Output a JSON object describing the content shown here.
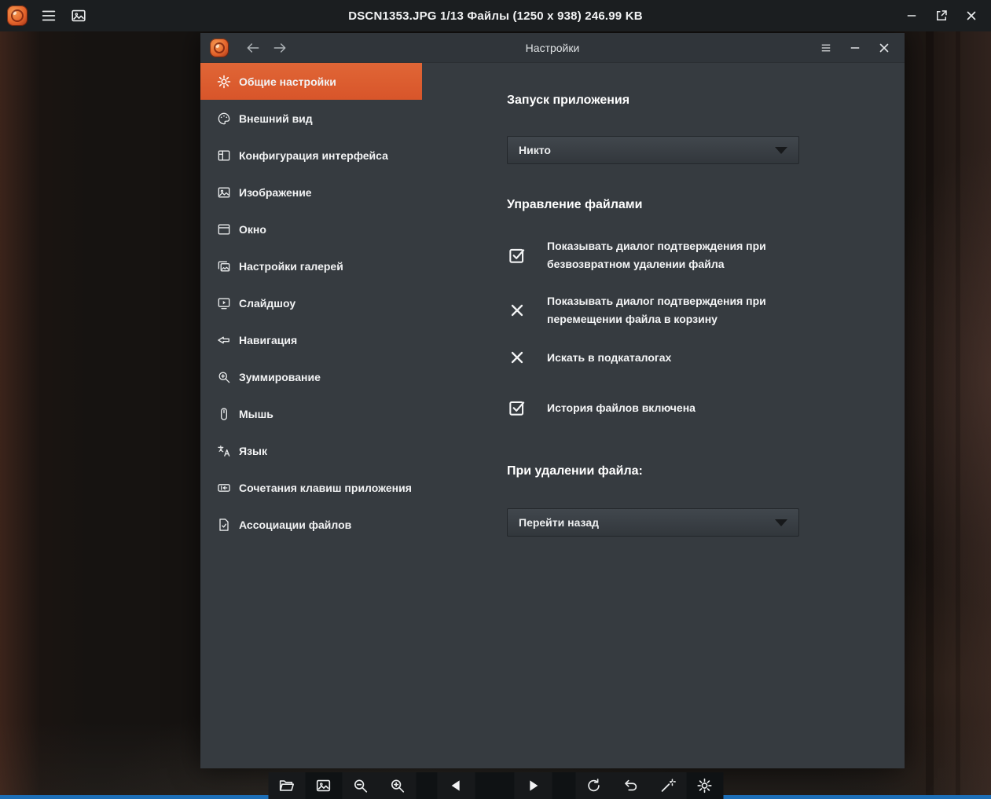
{
  "window": {
    "title": "DSCN1353.JPG 1/13 Файлы (1250 x 938) 246.99 KB",
    "controls": [
      "minimize",
      "detach",
      "close"
    ],
    "topbar_icons": [
      "menu-icon",
      "thumbnails-icon"
    ]
  },
  "colors": {
    "accent_orange": "#de5f2d",
    "topbar_bg": "#1b1e20",
    "dialog_bg": "#363b40",
    "toolbar_bg": "#17191b",
    "bottom_strip_blue": "#1d6fb7"
  },
  "dialog": {
    "title": "Настройки",
    "nav_icons": [
      "back-arrow",
      "forward-arrow"
    ],
    "controls": [
      "menu",
      "minimize",
      "close"
    ],
    "sidebar": [
      {
        "label": "Общие настройки",
        "icon": "gear-icon",
        "selected": true
      },
      {
        "label": "Внешний вид",
        "icon": "palette-icon",
        "selected": false
      },
      {
        "label": "Конфигурация интерфейса",
        "icon": "layout-icon",
        "selected": false
      },
      {
        "label": "Изображение",
        "icon": "image-icon",
        "selected": false
      },
      {
        "label": "Окно",
        "icon": "window-icon",
        "selected": false
      },
      {
        "label": "Настройки галерей",
        "icon": "gallery-icon",
        "selected": false
      },
      {
        "label": "Слайдшоу",
        "icon": "slideshow-icon",
        "selected": false
      },
      {
        "label": "Навигация",
        "icon": "navigation-arrow-icon",
        "selected": false
      },
      {
        "label": "Зуммирование",
        "icon": "zoom-icon",
        "selected": false
      },
      {
        "label": "Мышь",
        "icon": "mouse-icon",
        "selected": false
      },
      {
        "label": "Язык",
        "icon": "language-icon",
        "selected": false
      },
      {
        "label": "Сочетания клавиш приложения",
        "icon": "keyboard-shortcut-icon",
        "selected": false
      },
      {
        "label": "Ассоциации файлов",
        "icon": "file-check-icon",
        "selected": false
      }
    ],
    "content": {
      "section1_title": "Запуск приложения",
      "dropdown1_value": "Никто",
      "section2_title": "Управление файлами",
      "checkboxes": [
        {
          "checked": true,
          "label": "Показывать диалог подтверждения при безвозвратном удалении файла"
        },
        {
          "checked": false,
          "label": "Показывать диалог подтверждения при перемещении файла в корзину"
        },
        {
          "checked": false,
          "label": "Искать в подкаталогах"
        },
        {
          "checked": true,
          "label": "История файлов включена"
        }
      ],
      "section3_title": "При удалении файла:",
      "dropdown2_value": "Перейти назад"
    }
  },
  "toolbar": {
    "buttons": [
      "open-folder-icon",
      "gallery-image-icon",
      "zoom-out-icon",
      "zoom-in-icon",
      "previous-icon",
      "next-icon",
      "rotate-icon",
      "undo-icon",
      "magic-wand-icon",
      "gear-icon"
    ]
  }
}
